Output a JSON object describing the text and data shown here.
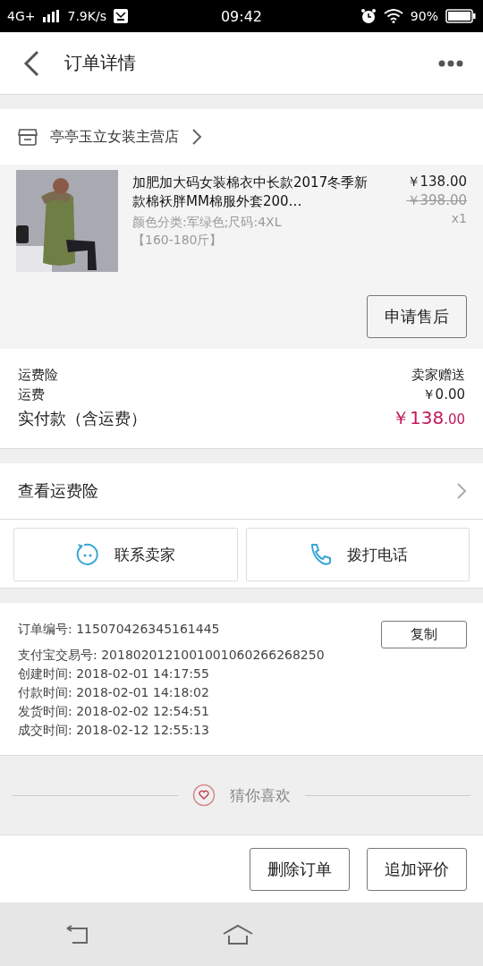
{
  "status_bar": {
    "network": "4G+",
    "speed": "7.9K/s",
    "time": "09:42",
    "battery": "90%"
  },
  "header": {
    "title": "订单详情"
  },
  "shop": {
    "name": "亭亭玉立女装主营店"
  },
  "product": {
    "title": "加肥加大码女装棉衣中长款2017冬季新款棉袄胖MM棉服外套200…",
    "sku": "颜色分类:军绿色;尺码:4XL【160-180斤】",
    "price": "￥138.00",
    "original_price": "￥398.00",
    "quantity": "x1",
    "action": "申请售后"
  },
  "fees": [
    {
      "label": "运费险",
      "value": "卖家赠送",
      "kind": "plain"
    },
    {
      "label": "运费",
      "value": "￥0.00",
      "kind": "plain"
    },
    {
      "label": "实付款（含运费）",
      "value": "￥138",
      "value_small": ".00",
      "kind": "total"
    }
  ],
  "insurance_link": "查看运费险",
  "contact_buttons": [
    {
      "label": "联系卖家",
      "kind": "chat"
    },
    {
      "label": "拨打电话",
      "kind": "phone"
    }
  ],
  "order_info": {
    "copy_button": "复制",
    "lines": [
      {
        "label": "订单编号:",
        "value": "115070426345161445"
      },
      {
        "label": "支付宝交易号:",
        "value": "2018020121001001060266268250"
      },
      {
        "label": "创建时间:",
        "value": "2018-02-01 14:17:55"
      },
      {
        "label": "付款时间:",
        "value": "2018-02-01 14:18:02"
      },
      {
        "label": "发货时间:",
        "value": "2018-02-02 12:54:51"
      },
      {
        "label": "成交时间:",
        "value": "2018-02-12 12:55:13"
      }
    ]
  },
  "recommend": {
    "title": "猜你喜欢"
  },
  "bottom_actions": [
    "删除订单",
    "追加评价"
  ]
}
